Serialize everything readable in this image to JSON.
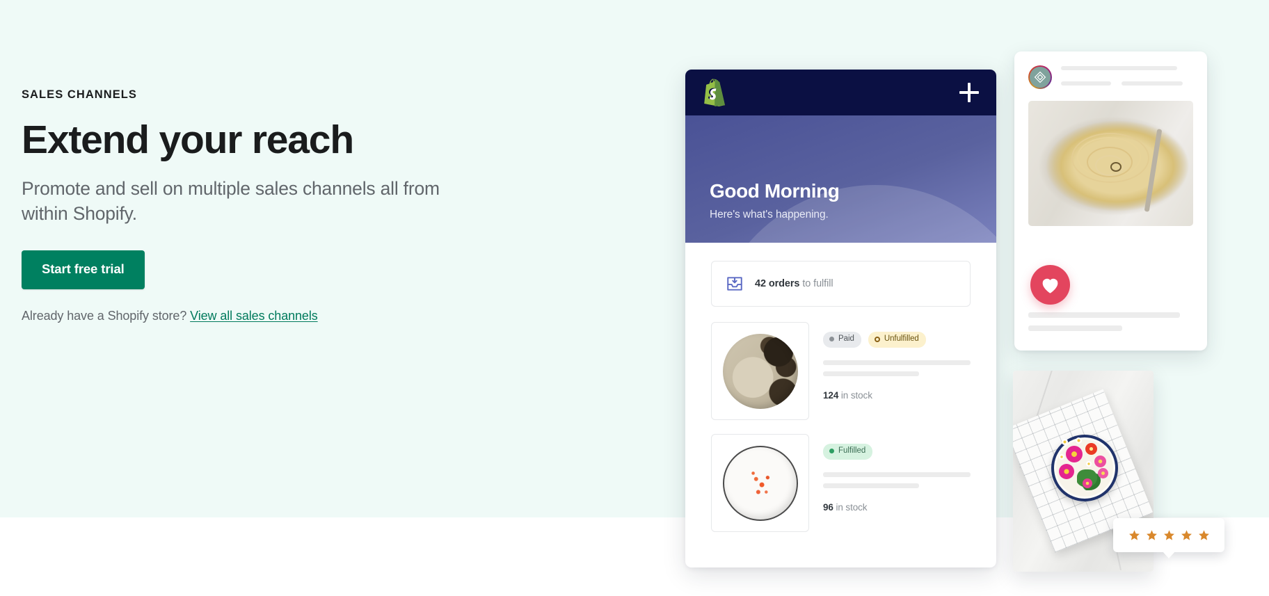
{
  "theme": {
    "background_mint": "#effaf7",
    "background_white": "#ffffff",
    "brand_green": "#008060",
    "link_green": "#007a5c",
    "navy": "#0b1043",
    "hero_purple": "#4a5296",
    "heart_red": "#e3455e",
    "star_orange": "#d9882c",
    "text_dark": "#1a1c1d",
    "text_muted": "#61666b"
  },
  "hero": {
    "eyebrow": "SALES CHANNELS",
    "headline": "Extend your reach",
    "subhead": "Promote and sell on multiple sales channels all from within Shopify.",
    "cta_label": "Start free trial",
    "secondary_prefix": "Already have a Shopify store?",
    "secondary_link": "View all sales channels"
  },
  "phone": {
    "topbar": {
      "logo_icon": "shopify-bag-icon",
      "add_icon": "plus-icon"
    },
    "greeting": "Good Morning",
    "greeting_sub": "Here's what's happening.",
    "orders_card": {
      "icon": "orders-inbox-icon",
      "count": "42 orders",
      "suffix": " to fulfill"
    },
    "products": [
      {
        "thumb_name": "speckled-stoneware-plate-thumbnail",
        "badges": [
          {
            "label": "Paid",
            "style": "paid",
            "dot_icon": "filled-dot-icon"
          },
          {
            "label": "Unfulfilled",
            "style": "unfulfilled",
            "dot_icon": "ring-dot-icon"
          }
        ],
        "stock_count": "124",
        "stock_suffix": " in stock"
      },
      {
        "thumb_name": "white-splatter-plate-thumbnail",
        "badges": [
          {
            "label": "Fulfilled",
            "style": "fulfilled",
            "dot_icon": "filled-dot-icon"
          }
        ],
        "stock_count": "96",
        "stock_suffix": " in stock"
      }
    ]
  },
  "instagram_card": {
    "avatar_icon": "diamond-logo-avatar-icon",
    "photo_name": "pasta-carbonara-photo",
    "heart_icon": "heart-icon"
  },
  "food_card": {
    "photo_name": "edible-flowers-bowl-photo"
  },
  "rating_badge": {
    "stars": 5,
    "star_icon": "star-icon"
  }
}
